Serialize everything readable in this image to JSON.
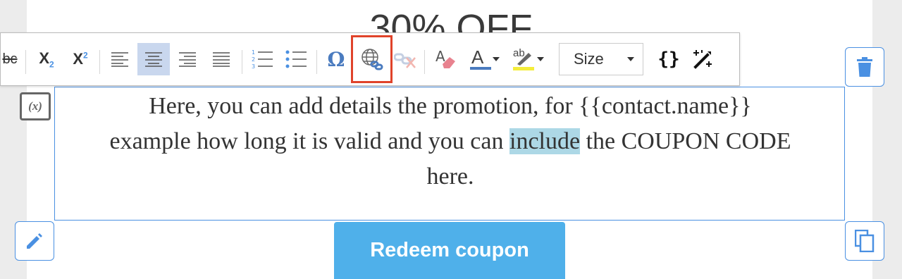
{
  "headline": "30% OFF",
  "body": {
    "line1": "Here, you can add details  the promotion, for {{contact.name}}",
    "line2_before": "example how long it is valid and you can ",
    "line2_highlight": "include",
    "line2_after": " the COUPON CODE",
    "line3": "here."
  },
  "variable_badge": "(x)",
  "coupon_button": "Redeem coupon",
  "toolbar": {
    "strikethrough": "bc",
    "subscript_base": "X",
    "subscript_mark": "2",
    "superscript_base": "X",
    "superscript_mark": "2",
    "omega": "Ω",
    "font_color_label": "A",
    "highlight_label": "ab",
    "size_label": "Size",
    "source_label": "{}"
  },
  "colors": {
    "accent": "#4a90e2",
    "button": "#4fb0ea",
    "selection": "#add8e6",
    "focus_box": "#e0432a"
  }
}
